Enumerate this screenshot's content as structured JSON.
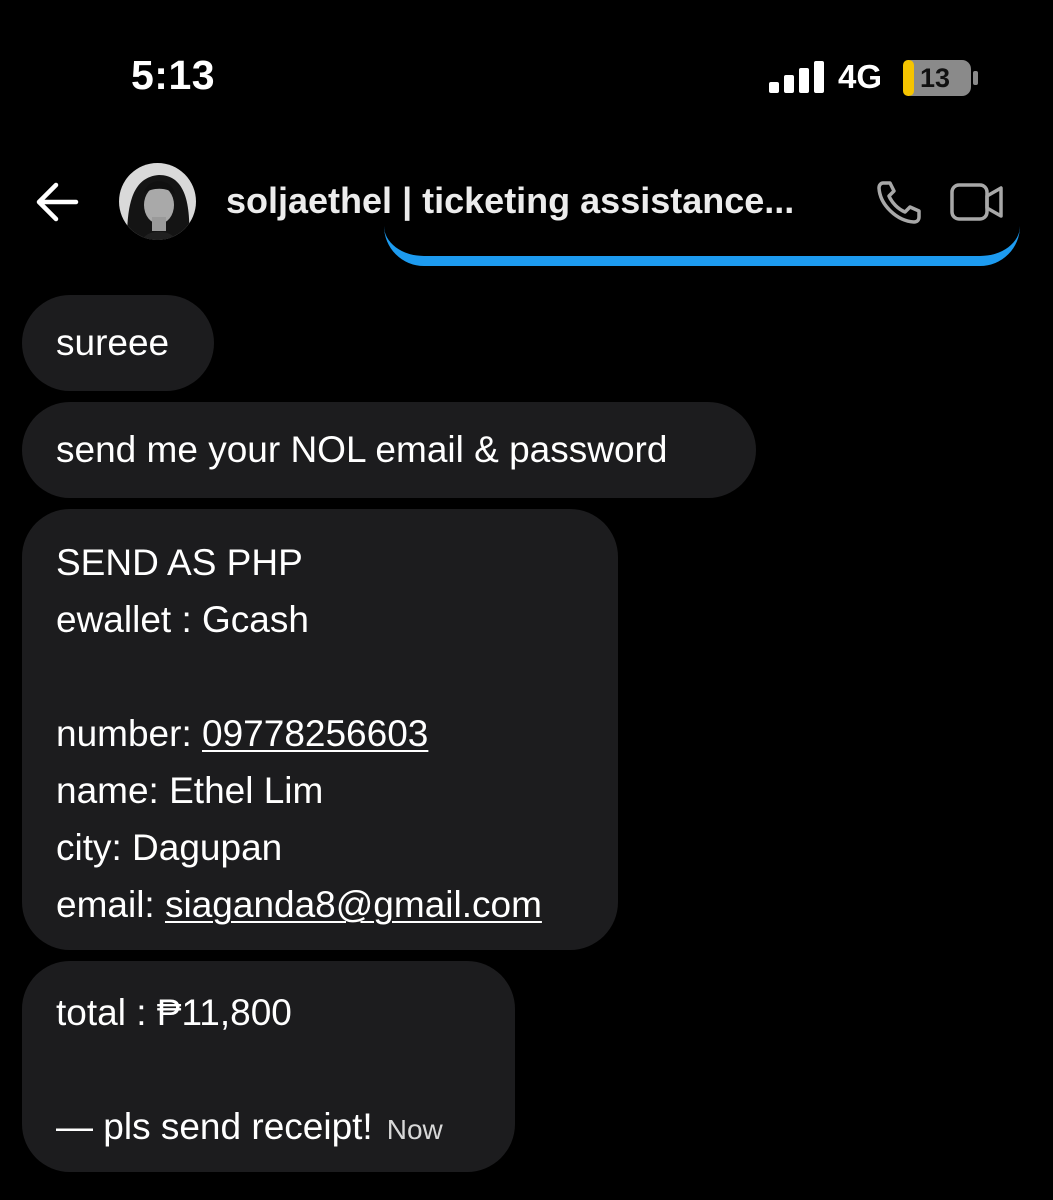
{
  "status_bar": {
    "time": "5:13",
    "network": "4G",
    "battery": "13"
  },
  "header": {
    "contact_name": "soljaethel | ticketing assistance..."
  },
  "messages": [
    {
      "lines": [
        "sureee"
      ]
    },
    {
      "lines": [
        "send me your NOL email & password"
      ]
    },
    {
      "send_as": "SEND AS PHP",
      "ewallet": "ewallet : Gcash",
      "number_label": "number: ",
      "number": "09778256603",
      "name": "name: Ethel Lim",
      "city": "city: Dagupan",
      "email_label": "email: ",
      "email": "siaganda8@gmail.com"
    },
    {
      "total": "total : ₱11,800",
      "note": "— pls send receipt!",
      "timestamp": "Now"
    }
  ],
  "colors": {
    "background": "#000000",
    "bubble": "#1c1c1e",
    "accent": "#1d9bf0",
    "battery_low": "#f5c400"
  },
  "icons": [
    "back-arrow-icon",
    "phone-icon",
    "video-camera-icon",
    "signal-icon",
    "battery-icon"
  ]
}
